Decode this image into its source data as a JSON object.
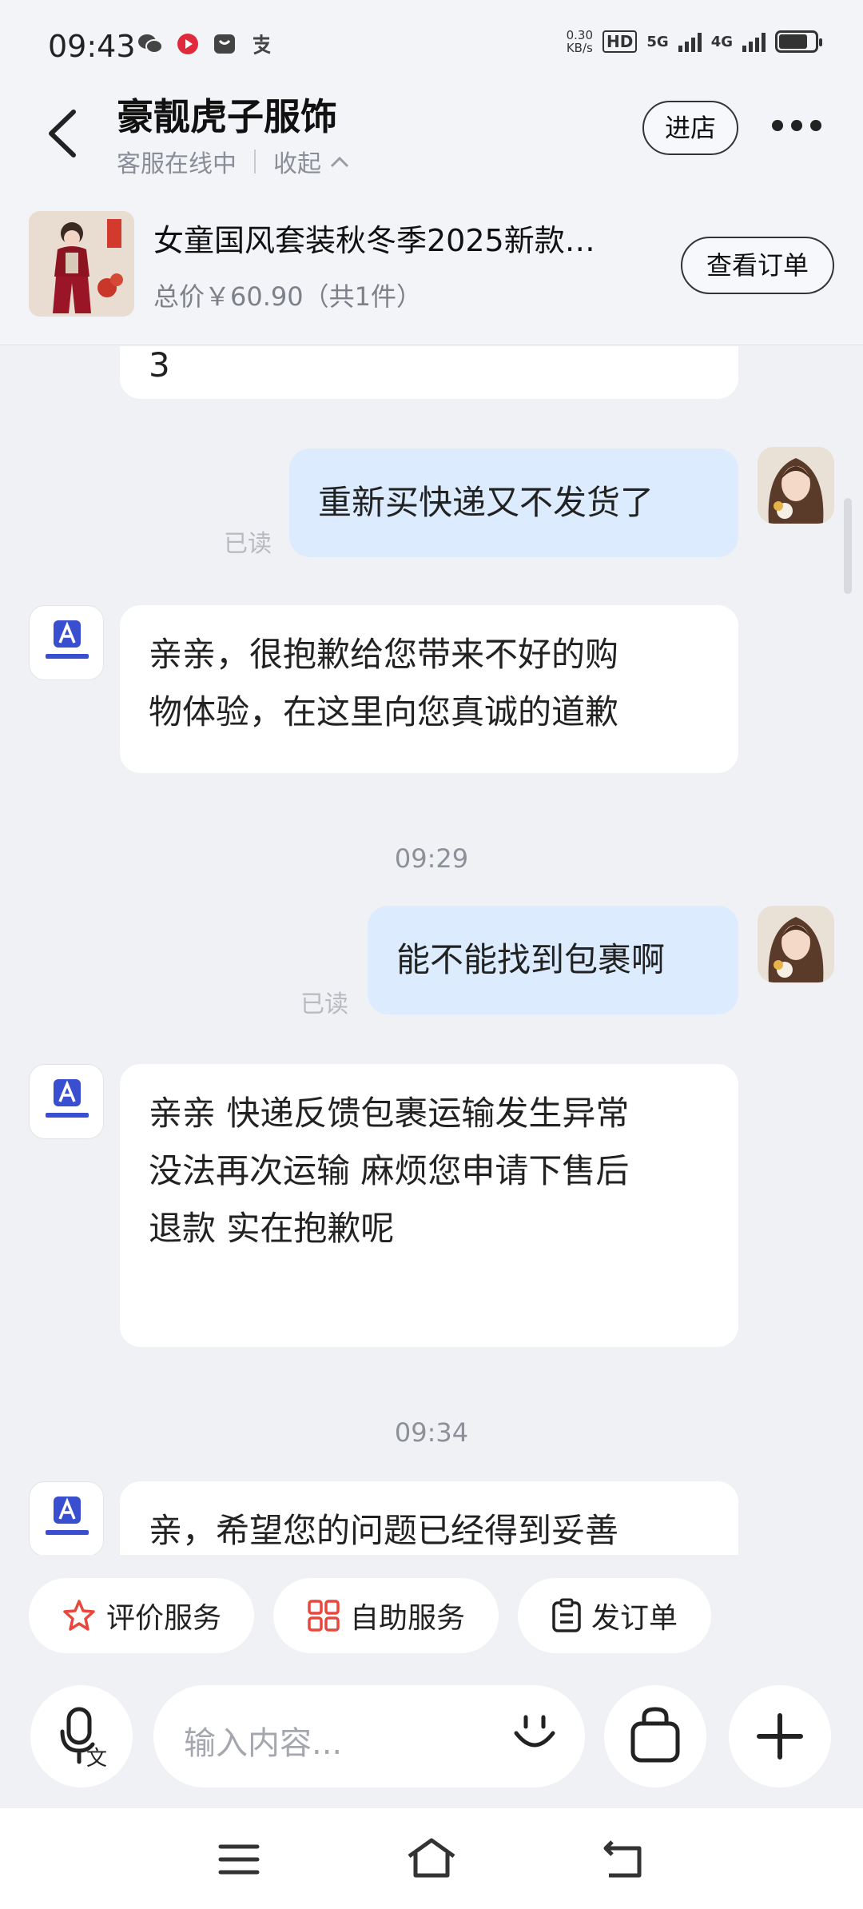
{
  "status_bar": {
    "time": "09:43",
    "app_icons": [
      "wechat-icon",
      "record-icon",
      "bag-icon",
      "alipay-icon"
    ],
    "net_speed_value": "0.30",
    "net_speed_unit": "KB/s",
    "hd_label": "HD",
    "net1": "5G",
    "net2": "4G",
    "battery_level": 0.75
  },
  "header": {
    "shop_name": "豪靓虎子服饰",
    "status": "客服在线中",
    "collapse": "收起",
    "store_button": "进店"
  },
  "order": {
    "title": "女童国风套装秋冬季2025新款…",
    "price": "总价￥60.90（共1件）",
    "view_button": "查看订单"
  },
  "messages": {
    "partial_top": "3",
    "m1": "重新买快递又不发货了",
    "m1_status": "已读",
    "m2_line1": "亲亲，很抱歉给您带来不好的购",
    "m2_line2": "物体验，在这里向您真诚的道歉",
    "time1": "09:29",
    "m3": "能不能找到包裹啊",
    "m3_status": "已读",
    "m4_line1": "亲亲 快递反馈包裹运输发生异常",
    "m4_line2": "没法再次运输 麻烦您申请下售后",
    "m4_line3": "退款 实在抱歉呢",
    "time2": "09:34",
    "m5_line1": "亲，希望您的问题已经得到妥善"
  },
  "quick_actions": {
    "rate": "评价服务",
    "self_service": "自助服务",
    "send_order": "发订单"
  },
  "input": {
    "placeholder": "输入内容..."
  },
  "colors": {
    "background": "#f0f1f5",
    "outgoing_bubble": "#dcecfe",
    "incoming_bubble": "#ffffff",
    "accent_red": "#e8473d",
    "shop_logo_blue": "#3a4fd0"
  }
}
